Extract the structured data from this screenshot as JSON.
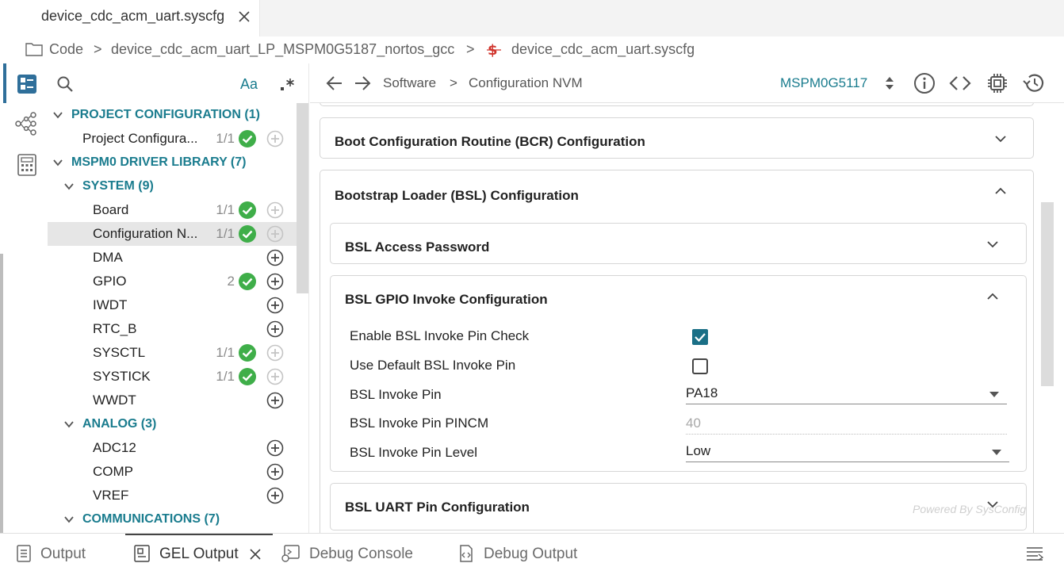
{
  "tab": {
    "title": "device_cdc_acm_uart.syscfg",
    "close": "close-tab"
  },
  "breadcrumb": {
    "root": "Code",
    "project": "device_cdc_acm_uart_LP_MSPM0G5187_nortos_gcc",
    "file": "device_cdc_acm_uart.syscfg",
    "separator": ">"
  },
  "activity": {
    "items": [
      "dashboard-icon",
      "hierarchy-icon",
      "calculator-icon"
    ]
  },
  "sidebar": {
    "search_icon": "search-icon",
    "case_toggle": "Aa",
    "regex_icon": "regex-icon",
    "tree": [
      {
        "label": "PROJECT CONFIGURATION (1)",
        "level": 0,
        "category": true,
        "expanded": true
      },
      {
        "label": "Project Configura...",
        "level": 1,
        "count": "1/1",
        "ok": true,
        "add_enabled": false
      },
      {
        "label": "MSPM0 DRIVER LIBRARY (7)",
        "level": 0,
        "category": true,
        "expanded": true
      },
      {
        "label": "SYSTEM (9)",
        "level": 1,
        "category": true,
        "expanded": true
      },
      {
        "label": "Board",
        "level": 2,
        "count": "1/1",
        "ok": true,
        "add_enabled": false
      },
      {
        "label": "Configuration N...",
        "level": 2,
        "count": "1/1",
        "ok": true,
        "add_enabled": false,
        "selected": true
      },
      {
        "label": "DMA",
        "level": 2,
        "count": "",
        "ok": false,
        "add_enabled": true
      },
      {
        "label": "GPIO",
        "level": 2,
        "count": "2",
        "ok": true,
        "add_enabled": true
      },
      {
        "label": "IWDT",
        "level": 2,
        "count": "",
        "ok": false,
        "add_enabled": true
      },
      {
        "label": "RTC_B",
        "level": 2,
        "count": "",
        "ok": false,
        "add_enabled": true
      },
      {
        "label": "SYSCTL",
        "level": 2,
        "count": "1/1",
        "ok": true,
        "add_enabled": false
      },
      {
        "label": "SYSTICK",
        "level": 2,
        "count": "1/1",
        "ok": true,
        "add_enabled": false
      },
      {
        "label": "WWDT",
        "level": 2,
        "count": "",
        "ok": false,
        "add_enabled": true
      },
      {
        "label": "ANALOG (3)",
        "level": 1,
        "category": true,
        "expanded": true
      },
      {
        "label": "ADC12",
        "level": 2,
        "count": "",
        "ok": false,
        "add_enabled": true
      },
      {
        "label": "COMP",
        "level": 2,
        "count": "",
        "ok": false,
        "add_enabled": true
      },
      {
        "label": "VREF",
        "level": 2,
        "count": "",
        "ok": false,
        "add_enabled": true
      },
      {
        "label": "COMMUNICATIONS (7)",
        "level": 1,
        "category": true,
        "expanded": true
      }
    ]
  },
  "topbar": {
    "back": "back-arrow-icon",
    "forward": "forward-arrow-icon",
    "path_root": "Software",
    "path_sep": ">",
    "path_current": "Configuration NVM",
    "device": "MSPM0G5117",
    "icons": [
      "info-icon",
      "code-icon",
      "chip-icon",
      "history-icon"
    ]
  },
  "main": {
    "bcr_title": "Boot Configuration Routine (BCR) Configuration",
    "bsl_title": "Bootstrap Loader (BSL) Configuration",
    "bsl_password_title": "BSL Access Password",
    "bsl_gpio_title": "BSL GPIO Invoke Configuration",
    "fields": {
      "enable_invoke_label": "Enable BSL Invoke Pin Check",
      "enable_invoke_checked": true,
      "use_default_label": "Use Default BSL Invoke Pin",
      "use_default_checked": false,
      "invoke_pin_label": "BSL Invoke Pin",
      "invoke_pin_value": "PA18",
      "pincm_label": "BSL Invoke Pin PINCM",
      "pincm_value": "40",
      "pin_level_label": "BSL Invoke Pin Level",
      "pin_level_value": "Low"
    },
    "bsl_uart_title": "BSL UART Pin Configuration",
    "powered_by": "Powered By SysConfig"
  },
  "bottom_tabs": [
    {
      "label": "Output",
      "icon": "output-icon",
      "active": false
    },
    {
      "label": "GEL Output",
      "icon": "gel-output-icon",
      "active": true,
      "closable": true
    },
    {
      "label": "Debug Console",
      "icon": "debug-console-icon",
      "active": false
    },
    {
      "label": "Debug Output",
      "icon": "debug-output-icon",
      "active": false
    }
  ],
  "colors": {
    "accent": "#1a7c8e",
    "ok_green": "#3fae49",
    "checkbox": "#1a6f86",
    "selected_row": "#e6e6e6"
  }
}
